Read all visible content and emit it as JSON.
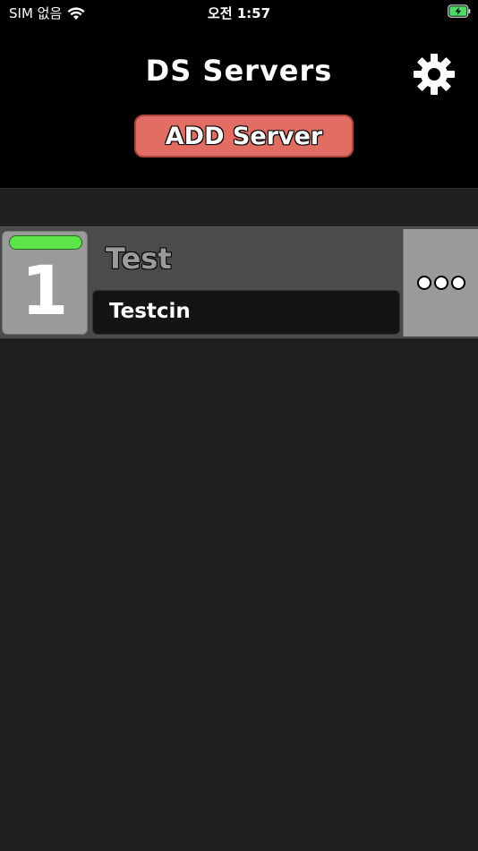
{
  "status_bar": {
    "carrier": "SIM 없음",
    "time": "오전 1:57",
    "battery_color": "#4cd964"
  },
  "header": {
    "title": "DS Servers",
    "settings_icon": "gear-icon",
    "add_button_label": "ADD Server",
    "add_button_color": "#e26e63"
  },
  "servers": [
    {
      "number": "1",
      "name": "Test",
      "subtitle": "Testcin",
      "status_color": "#5ce64a",
      "more_icon": "ellipsis-icon"
    }
  ]
}
